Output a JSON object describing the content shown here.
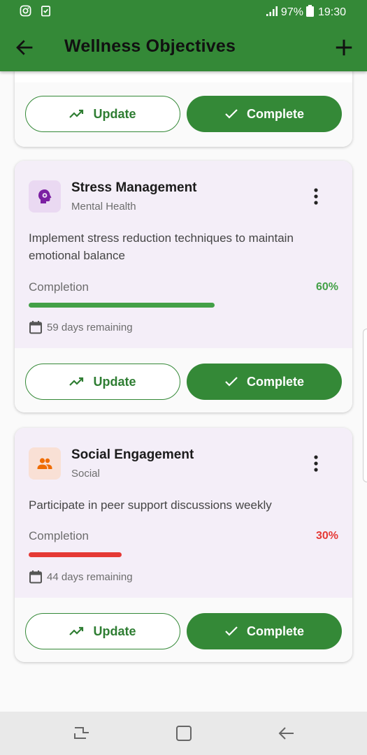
{
  "status_bar": {
    "battery": "97%",
    "time": "19:30",
    "left_icons": [
      "instagram-icon",
      "clipboard-check-icon"
    ],
    "right_icons": [
      "signal-icon",
      "battery-icon"
    ]
  },
  "app_bar": {
    "title": "Wellness Objectives",
    "back_icon": "arrow-left-icon",
    "add_icon": "plus-icon"
  },
  "buttons": {
    "update_label": "Update",
    "complete_label": "Complete"
  },
  "goals": [
    {
      "title": "Stress Management",
      "category": "Mental Health",
      "icon": "brain-gear-icon",
      "icon_color": "#7b1fa2",
      "description": "Implement stress reduction techniques to maintain emotional balance",
      "completion_label": "Completion",
      "progress": 0.6,
      "progress_text": "60%",
      "progress_color": "#43a047",
      "days_remaining": "59 days remaining"
    },
    {
      "title": "Social Engagement",
      "category": "Social",
      "icon": "people-icon",
      "icon_color": "#ef6c00",
      "description": "Participate in peer support discussions weekly",
      "completion_label": "Completion",
      "progress": 0.3,
      "progress_text": "30%",
      "progress_color": "#e53935",
      "days_remaining": "44 days remaining"
    }
  ],
  "colors": {
    "primary": "#348937",
    "card_body": "#f4eef8"
  },
  "nav_bar": {
    "icons": [
      "recent-apps-icon",
      "home-icon",
      "back-icon"
    ]
  }
}
